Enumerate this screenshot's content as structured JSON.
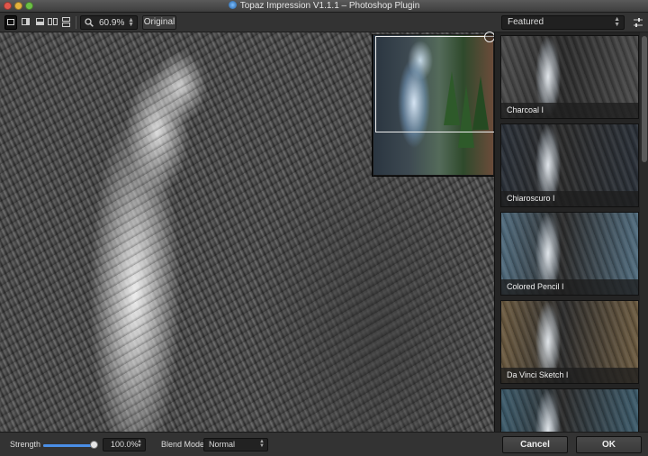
{
  "window": {
    "title": "Topaz Impression V1.1.1 – Photoshop Plugin",
    "app_icon": "topaz-icon"
  },
  "toolbar": {
    "view_modes": [
      "single-view",
      "split-vertical",
      "split-horizontal",
      "side-by-side",
      "stacked"
    ],
    "active_view": "single-view",
    "zoom_value": "60.9%",
    "original_label": "Original"
  },
  "preset_panel": {
    "category": "Featured",
    "presets": [
      {
        "label": "Charcoal I",
        "tone": "#4a4a4a"
      },
      {
        "label": "Chiaroscuro I",
        "tone": "#2a3038"
      },
      {
        "label": "Colored Pencil I",
        "tone": "#4f6a7c"
      },
      {
        "label": "Da Vinci Sketch I",
        "tone": "#6b5a40"
      },
      {
        "label": "",
        "tone": "#3c5a6a"
      }
    ]
  },
  "bottom": {
    "strength_label": "Strength",
    "strength_value": "100.0%",
    "strength_level": 1.0,
    "blend_mode_label": "Blend Mode",
    "blend_mode_value": "Normal",
    "cancel_label": "Cancel",
    "ok_label": "OK"
  },
  "colors": {
    "accent": "#4a8ee6",
    "panel": "#242424",
    "toolbar": "#333333"
  }
}
